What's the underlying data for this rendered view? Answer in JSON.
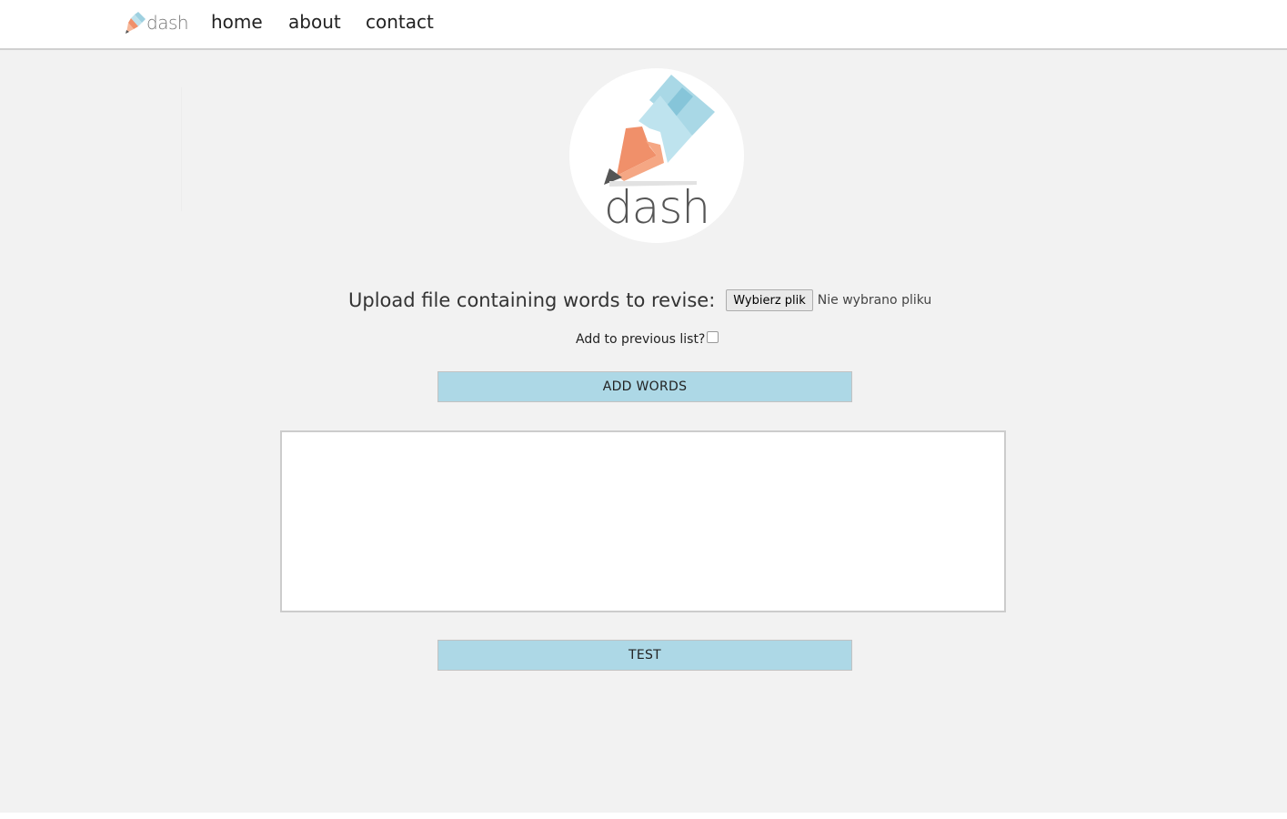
{
  "nav": {
    "logo_text": "dash",
    "links": [
      "home",
      "about",
      "contact"
    ]
  },
  "hero": {
    "logo_text": "dash"
  },
  "upload": {
    "label": "Upload file containing words to revise:",
    "button_label": "Wybierz plik",
    "status": "Nie wybrano pliku"
  },
  "append": {
    "label": "Add to previous list?",
    "checked": false
  },
  "actions": {
    "add_words_label": "ADD WORDS",
    "test_label": "TEST"
  },
  "words_box": {
    "content": ""
  },
  "colors": {
    "page_bg": "#f2f2f2",
    "button_bg": "#add8e6",
    "pencil_blue": "#9ed0e0",
    "pencil_orange": "#f0906a",
    "pencil_tip": "#555555"
  },
  "icons": {
    "nav_logo": "pencil-logo-icon",
    "hero_logo": "pencil-logo-icon",
    "checkbox": "checkbox-unchecked"
  }
}
